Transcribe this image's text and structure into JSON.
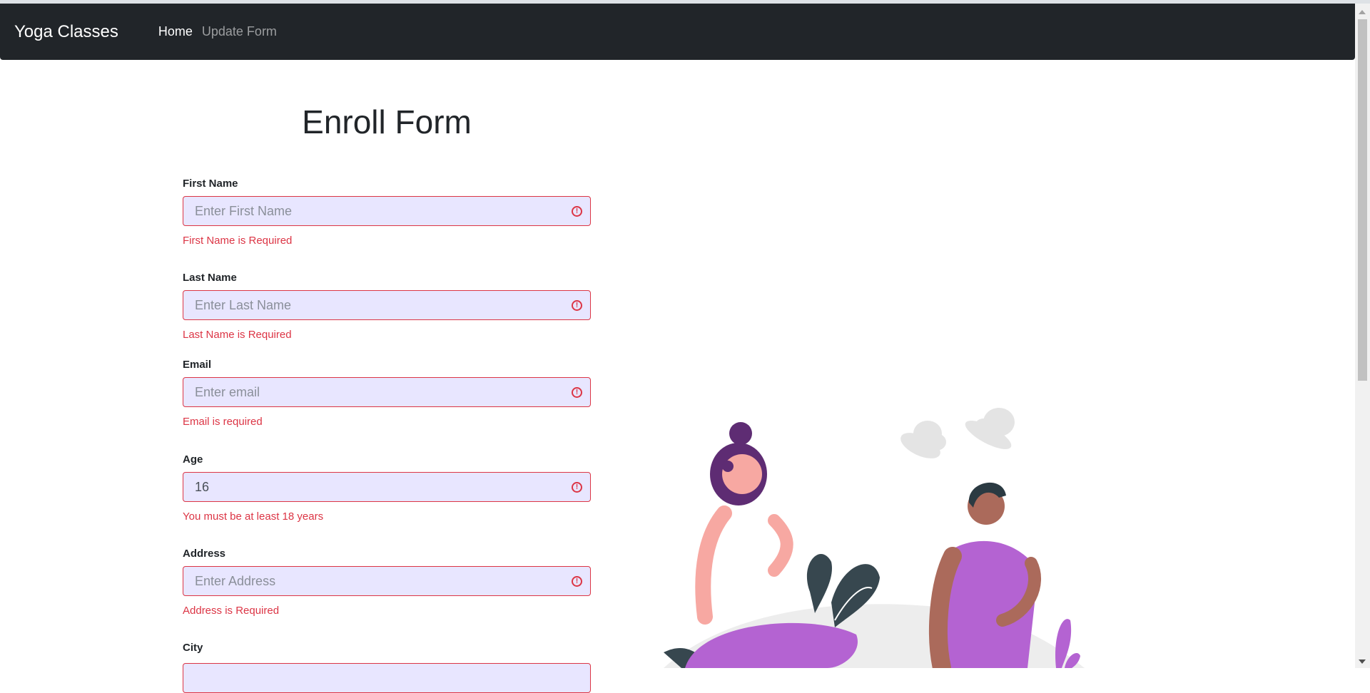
{
  "nav": {
    "brand": "Yoga Classes",
    "links": [
      {
        "label": "Home",
        "active": true
      },
      {
        "label": "Update Form",
        "active": false
      }
    ]
  },
  "form": {
    "title": "Enroll Form",
    "fields": [
      {
        "label": "First Name",
        "placeholder": "Enter First Name",
        "value": "",
        "error": "First Name is Required"
      },
      {
        "label": "Last Name",
        "placeholder": "Enter Last Name",
        "value": "",
        "error": "Last Name is Required"
      },
      {
        "label": "Email",
        "placeholder": "Enter email",
        "value": "",
        "error": "Email is required"
      },
      {
        "label": "Age",
        "placeholder": "",
        "value": "16",
        "error": "You must be at least 18 years"
      },
      {
        "label": "Address",
        "placeholder": "Enter Address",
        "value": "",
        "error": "Address is Required"
      },
      {
        "label": "City"
      }
    ],
    "invalid_icon": "exclamation-circle-icon"
  },
  "colors": {
    "navbar": "#212529",
    "error": "#dc3545",
    "input_bg": "#e8e6ff",
    "accent_purple": "#b463d2"
  }
}
